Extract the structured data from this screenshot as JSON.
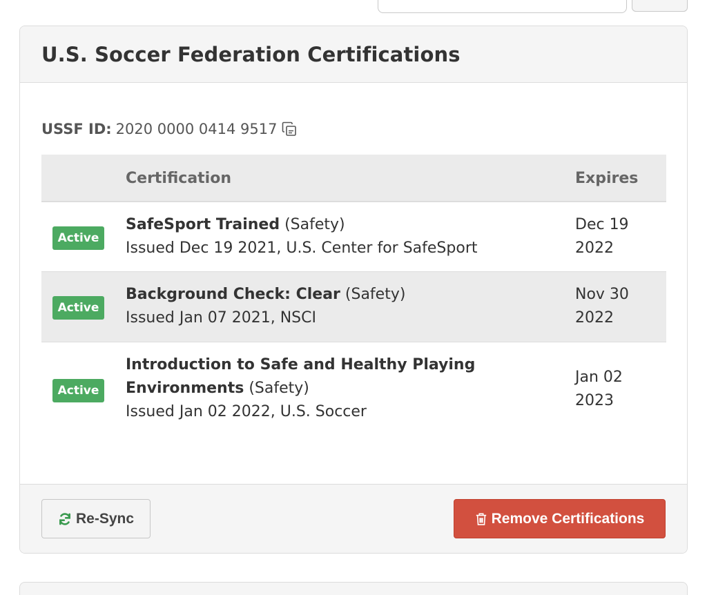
{
  "panel": {
    "title": "U.S. Soccer Federation Certifications",
    "ussf_id_label": "USSF ID:",
    "ussf_id_value": "2020 0000 0414 9517"
  },
  "table": {
    "columns": [
      "",
      "Certification",
      "Expires"
    ],
    "rows": [
      {
        "status": "Active",
        "name": "SafeSport Trained",
        "name_line2": "",
        "category": "(Safety)",
        "issued": "Issued Dec 19 2021, U.S. Center for SafeSport",
        "expires_line1": "Dec 19",
        "expires_line2": "2022"
      },
      {
        "status": "Active",
        "name": "Background Check: Clear",
        "name_line2": "",
        "category": "(Safety)",
        "issued": "Issued Jan 07 2021, NSCI",
        "expires_line1": "Nov 30",
        "expires_line2": "2022"
      },
      {
        "status": "Active",
        "name": "Introduction to Safe and Healthy Playing",
        "name_line2": "Environments",
        "category": "(Safety)",
        "issued": "Issued Jan 02 2022, U.S. Soccer",
        "expires_line1": "Jan 02",
        "expires_line2": "2023"
      }
    ]
  },
  "footer": {
    "resync_label": "Re-Sync",
    "remove_label": "Remove Certifications"
  },
  "icons": {
    "copy": "copy-icon",
    "refresh": "refresh-icon",
    "trash": "trash-icon"
  },
  "colors": {
    "active_badge": "#4caa61",
    "danger": "#d2503f",
    "refresh_icon": "#3a9a4f"
  }
}
